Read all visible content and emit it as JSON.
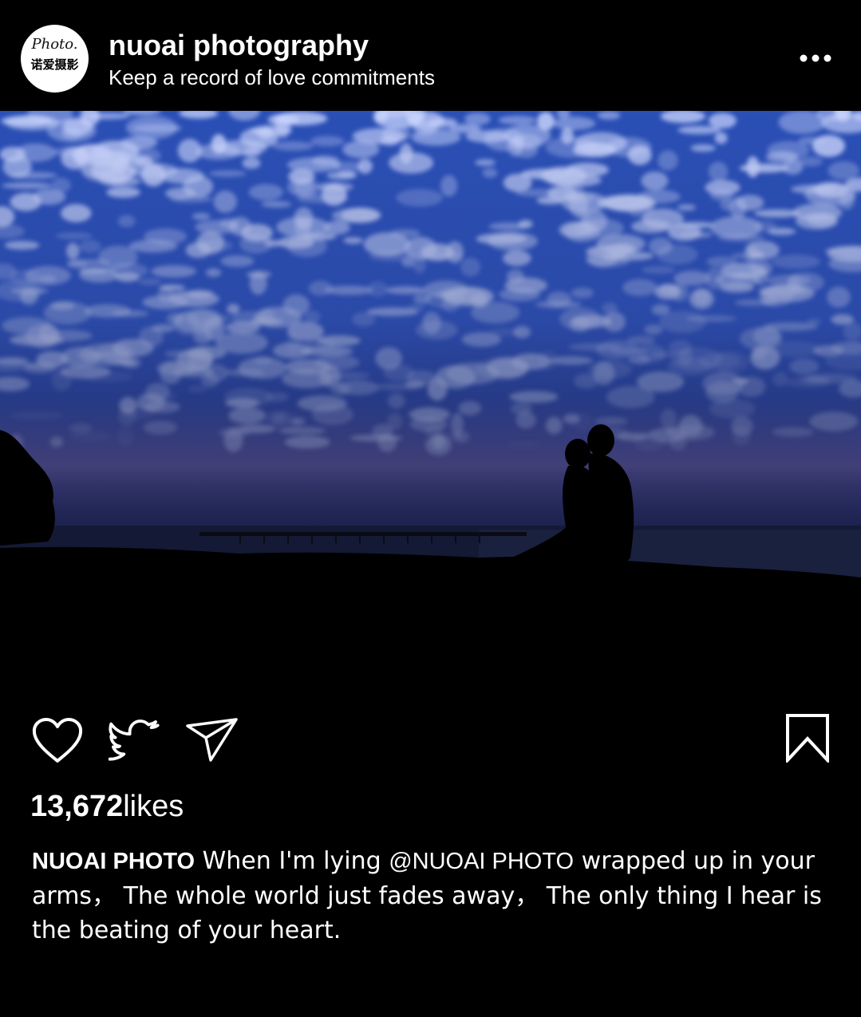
{
  "header": {
    "avatar_script": "Photo.",
    "avatar_label": "诺爱摄影",
    "account_name": "nuoai photography",
    "tagline": "Keep a record of love commitments",
    "more_icon": "more-horizontal-icon"
  },
  "post": {
    "photo_alt": "Silhouetted couple kissing by the sea under a blue cloud-filled sky",
    "actions": {
      "like_icon": "heart-icon",
      "share_icon": "twitter-bird-icon",
      "send_icon": "paper-plane-icon",
      "save_icon": "bookmark-icon"
    },
    "likes_count": "13,672",
    "likes_suffix": "likes",
    "caption": {
      "user": "NUOAI PHOTO",
      "text_before": " When I'm lying ",
      "mention": "@NUOAI PHOTO",
      "text_after": " wrapped up in your arms， The whole world just fades away， The only thing I hear is the beating of your heart."
    }
  },
  "colors": {
    "background": "#000000",
    "text": "#ffffff",
    "sky_blue": "#2f55b8"
  }
}
